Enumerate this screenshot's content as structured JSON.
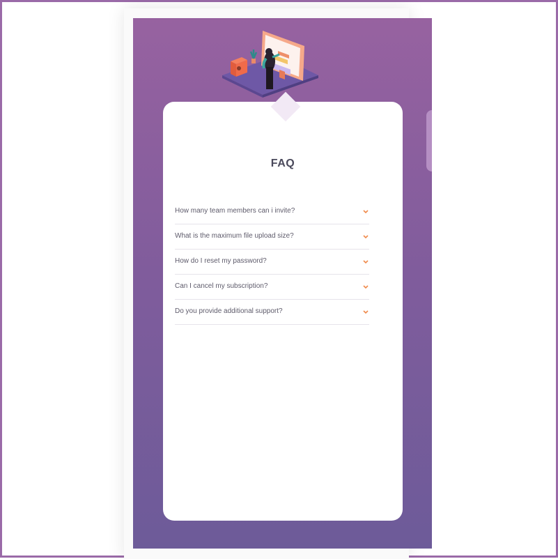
{
  "faq": {
    "title": "FAQ",
    "questions": [
      "How many team members can i invite?",
      "What is the maximum file upload size?",
      "How do I reset my password?",
      "Can I cancel my subscription?",
      "Do you provide additional support?"
    ]
  },
  "icons": {
    "chevron": "chevron-down-icon",
    "illustration": "person-at-screen-illustration"
  },
  "colors": {
    "frame": "#9a6aa8",
    "gradient_top": "#9762a0",
    "gradient_bottom": "#6d5b99",
    "accent": "#f08a4b",
    "title": "#4b4a5c",
    "text": "#5e5b6b"
  }
}
